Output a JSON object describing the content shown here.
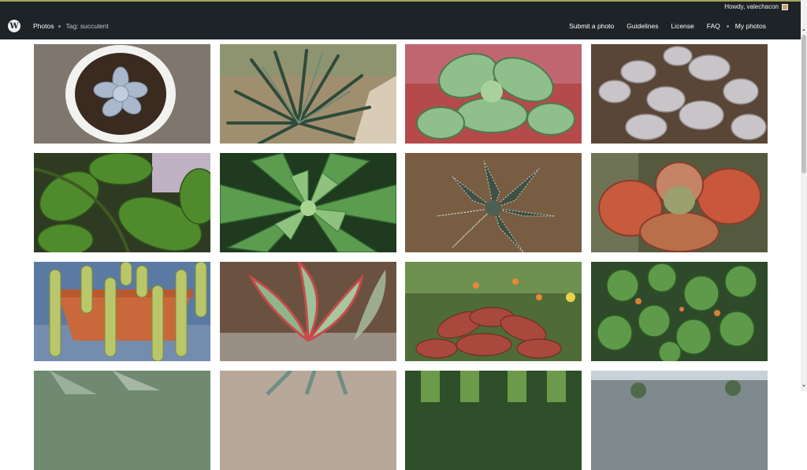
{
  "admin_bar": {
    "greeting": "Howdy, valechacon"
  },
  "header": {
    "breadcrumb": {
      "home": "Photos",
      "current": "Tag: succulent"
    },
    "nav": [
      "Submit a photo",
      "Guidelines",
      "License",
      "FAQ",
      "My photos"
    ]
  },
  "photos": [
    {
      "subject": "echeveria-in-white-pot"
    },
    {
      "subject": "agave-spiky"
    },
    {
      "subject": "kalanchoe-scalloped"
    },
    {
      "subject": "ghost-plant-rosettes"
    },
    {
      "subject": "jade-plant-leaves"
    },
    {
      "subject": "green-echeveria"
    },
    {
      "subject": "striped-haworthia"
    },
    {
      "subject": "red-paddle-plant"
    },
    {
      "subject": "burros-tail-hanging"
    },
    {
      "subject": "pink-edged-succulent"
    },
    {
      "subject": "red-crassula-garden"
    },
    {
      "subject": "crassula-round-leaves"
    },
    {
      "subject": "partial-green"
    },
    {
      "subject": "partial-grey"
    },
    {
      "subject": "partial-green-leaves"
    },
    {
      "subject": "partial-greenhouse"
    }
  ],
  "colors": {
    "header_bg": "#1d2327",
    "accent_line": "#a7a55e"
  }
}
